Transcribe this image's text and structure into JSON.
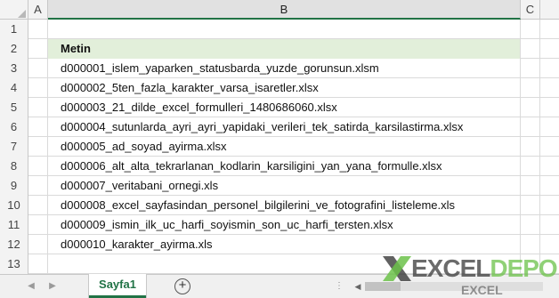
{
  "columns": [
    "A",
    "B",
    "C"
  ],
  "rows": [
    {
      "num": "1",
      "value": ""
    },
    {
      "num": "2",
      "value": "Metin"
    },
    {
      "num": "3",
      "value": "d000001_islem_yaparken_statusbarda_yuzde_gorunsun.xlsm"
    },
    {
      "num": "4",
      "value": "d000002_5ten_fazla_karakter_varsa_isaretler.xlsx"
    },
    {
      "num": "5",
      "value": "d000003_21_dilde_excel_formulleri_1480686060.xlsx"
    },
    {
      "num": "6",
      "value": "d000004_sutunlarda_ayri_ayri_yapidaki_verileri_tek_satirda_karsilastirma.xlsx"
    },
    {
      "num": "7",
      "value": "d000005_ad_soyad_ayirma.xlsx"
    },
    {
      "num": "8",
      "value": "d000006_alt_alta_tekrarlanan_kodlarin_karsiligini_yan_yana_formulle.xlsx"
    },
    {
      "num": "9",
      "value": "d000007_veritabani_ornegi.xls"
    },
    {
      "num": "10",
      "value": "d000008_excel_sayfasindan_personel_bilgilerini_ve_fotografini_listeleme.xls"
    },
    {
      "num": "11",
      "value": "d000009_ismin_ilk_uc_harfi_soyismin_son_uc_harfi_tersten.xlsx"
    },
    {
      "num": "12",
      "value": "d000010_karakter_ayirma.xls"
    },
    {
      "num": "13",
      "value": ""
    }
  ],
  "sheet_tab": "Sayfa1",
  "add_sheet_symbol": "+",
  "watermark": {
    "part1": "EXCEL",
    "part2": "DEPO",
    "small": "EXCEL"
  },
  "icons": {
    "nav_prev": "triangle-left-icon",
    "nav_next": "triangle-right-icon",
    "add_sheet": "plus-circle-icon"
  },
  "colors": {
    "accent": "#217346",
    "header_fill": "#e2efda"
  }
}
